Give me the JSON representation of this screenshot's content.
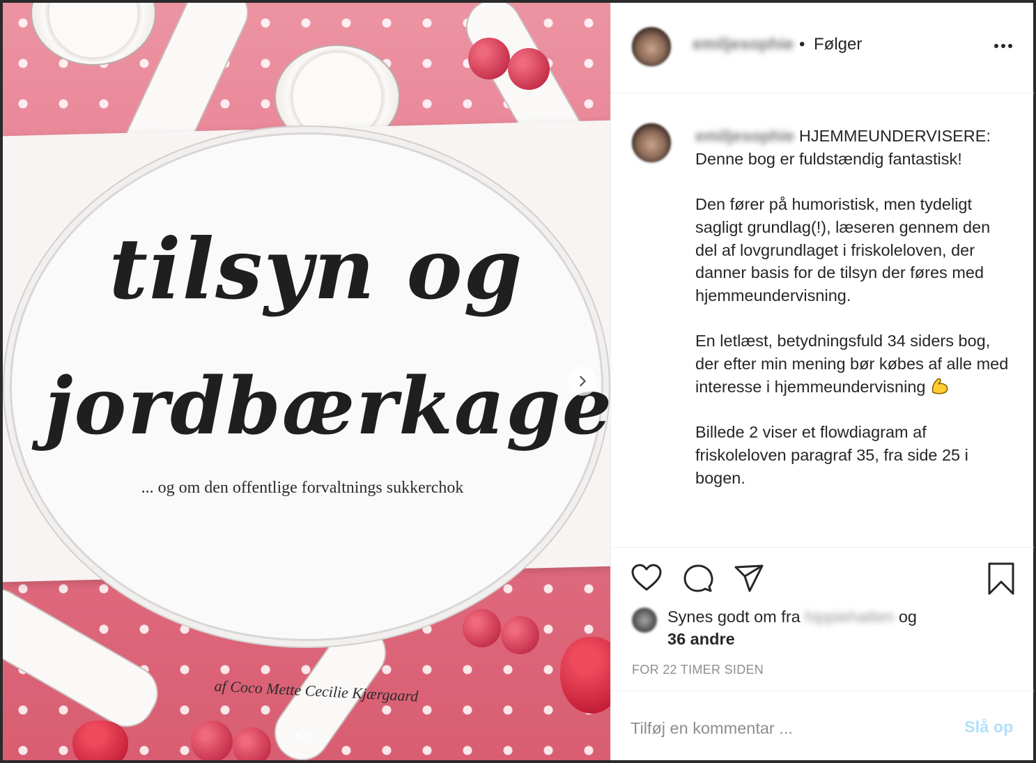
{
  "photo": {
    "book_title_line1": "tilsyn og",
    "book_title_line2": "jordbærkager",
    "book_subtitle": "... og om den offentlige forvaltnings sukkerchok",
    "book_author": "af Coco Mette Cecilie Kjærgaard",
    "carousel": {
      "current": 1,
      "total": 2
    },
    "next_icon": "chevron-right-icon"
  },
  "header": {
    "username": "emiljesophie",
    "separator": "•",
    "follow_label": "Følger",
    "more_icon": "more-horizontal-icon"
  },
  "caption": {
    "username": "emiljesophie",
    "first_line": "HJEMMEUNDERVISERE:",
    "line_2": "Denne bog er fuldstændig fantastisk!",
    "paragraph_2": "Den fører på humoristisk, men tydeligt sagligt grundlag(!), læseren gennem den del af lovgrundlaget i friskoleloven, der danner basis for de tilsyn der føres med hjemmeundervisning.",
    "paragraph_3": "En letlæst, betydningsfuld 34 siders bog, der efter min mening bør købes af alle med interesse i hjemmeundervisning",
    "paragraph_3_emoji": "flexed-biceps-emoji",
    "paragraph_4": "Billede 2 viser et flowdiagram af friskoleloven paragraf 35, fra side 25 i bogen."
  },
  "actions": {
    "like_icon": "heart-icon",
    "comment_icon": "comment-icon",
    "share_icon": "send-icon",
    "save_icon": "bookmark-icon",
    "likes_prefix": "Synes godt om fra",
    "liker_name": "hippiehatten",
    "likes_joiner": "og",
    "likes_others": "36 andre",
    "timestamp": "FOR 22 TIMER SIDEN"
  },
  "comment": {
    "placeholder": "Tilføj en kommentar ...",
    "post_label": "Slå op"
  },
  "colors": {
    "text": "#262626",
    "muted": "#8e8e8e",
    "post_disabled": "#b2dffc",
    "photo_pink": "#e8788a"
  }
}
